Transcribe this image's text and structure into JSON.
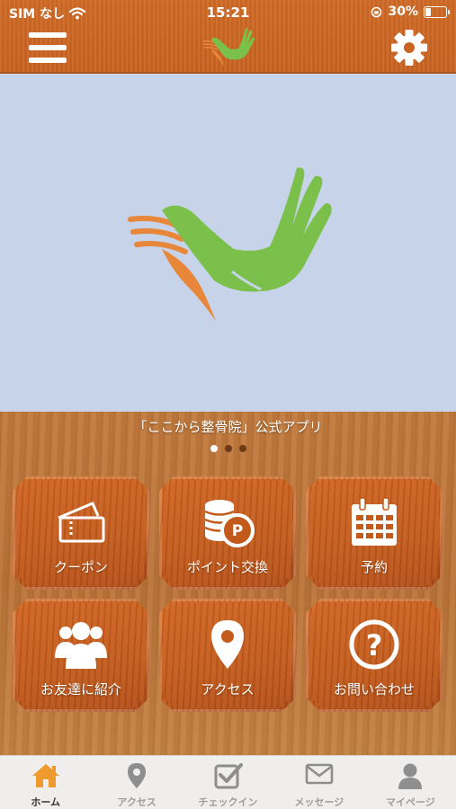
{
  "status_bar": {
    "carrier": "SIM なし",
    "time": "15:21",
    "battery": "30%",
    "battery_level": 0.3
  },
  "header": {
    "menu_icon": "hamburger-menu-icon",
    "logo_icon": "hand-bird-logo",
    "settings_icon": "gear-icon"
  },
  "caption": "「ここから整骨院」公式アプリ",
  "carousel": {
    "pages": 3,
    "active_index": 0
  },
  "tiles": [
    {
      "label": "クーポン",
      "icon": "ticket-icon"
    },
    {
      "label": "ポイント交換",
      "icon": "coins-icon"
    },
    {
      "label": "予約",
      "icon": "calendar-icon"
    },
    {
      "label": "お友達に紹介",
      "icon": "users-icon"
    },
    {
      "label": "アクセス",
      "icon": "map-pin-icon"
    },
    {
      "label": "お問い合わせ",
      "icon": "question-icon"
    }
  ],
  "tabbar": {
    "active": 0,
    "tabs": [
      {
        "label": "ホーム",
        "icon": "home-icon"
      },
      {
        "label": "アクセス",
        "icon": "map-pin-icon"
      },
      {
        "label": "チェックイン",
        "icon": "checkin-icon"
      },
      {
        "label": "メッセージ",
        "icon": "mail-icon"
      },
      {
        "label": "マイページ",
        "icon": "user-icon"
      }
    ]
  },
  "colors": {
    "header_orange": "#c86322",
    "hero_bg": "#c6d3e9",
    "logo_green": "#7cc04c",
    "logo_orange": "#e8873a",
    "tile_orange": "#c25a1b",
    "tab_active": "#ef9a2e"
  }
}
